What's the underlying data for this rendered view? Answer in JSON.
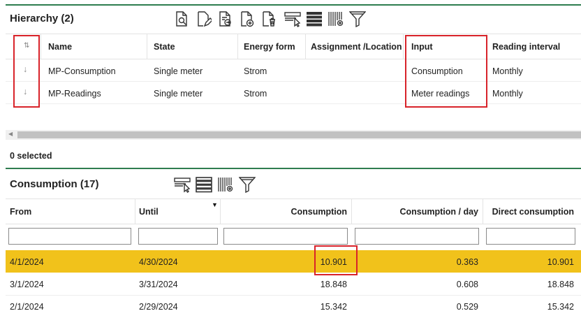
{
  "hierarchy": {
    "title": "Hierarchy (2)",
    "toolbar_icons": [
      "view-details-icon",
      "edit-icon",
      "export-icon",
      "add-document-icon",
      "delete-document-icon",
      "select-columns-icon",
      "list-view-icon",
      "column-settings-icon",
      "filter-icon"
    ],
    "columns": [
      "Name",
      "State",
      "Energy form",
      "Assignment /Location",
      "Input",
      "Reading interval"
    ],
    "sort_icon": "sort-icon",
    "rows": [
      {
        "arrow": "↓",
        "name": "MP-Consumption",
        "state": "Single meter",
        "energy": "Strom",
        "location": "",
        "input": "Consumption",
        "interval": "Monthly"
      },
      {
        "arrow": "↓",
        "name": "MP-Readings",
        "state": "Single meter",
        "energy": "Strom",
        "location": "",
        "input": "Meter readings",
        "interval": "Monthly"
      }
    ],
    "selected_text": "0 selected"
  },
  "consumption": {
    "title": "Consumption (17)",
    "toolbar_icons": [
      "select-columns-icon",
      "list-view-icon",
      "column-settings-icon",
      "filter-icon"
    ],
    "columns": [
      "From",
      "Until",
      "Consumption",
      "Consumption / day",
      "Direct consumption"
    ],
    "rows": [
      {
        "from": "4/1/2024",
        "until": "4/30/2024",
        "consumption": "10.901",
        "per_day": "0.363",
        "direct": "10.901"
      },
      {
        "from": "3/1/2024",
        "until": "3/31/2024",
        "consumption": "18.848",
        "per_day": "0.608",
        "direct": "18.848"
      },
      {
        "from": "2/1/2024",
        "until": "2/29/2024",
        "consumption": "15.342",
        "per_day": "0.529",
        "direct": "15.342"
      }
    ]
  },
  "colors": {
    "accent_line": "#2e7d4f",
    "highlight_row": "#f1c21b",
    "annotation_box": "#d8232a"
  }
}
